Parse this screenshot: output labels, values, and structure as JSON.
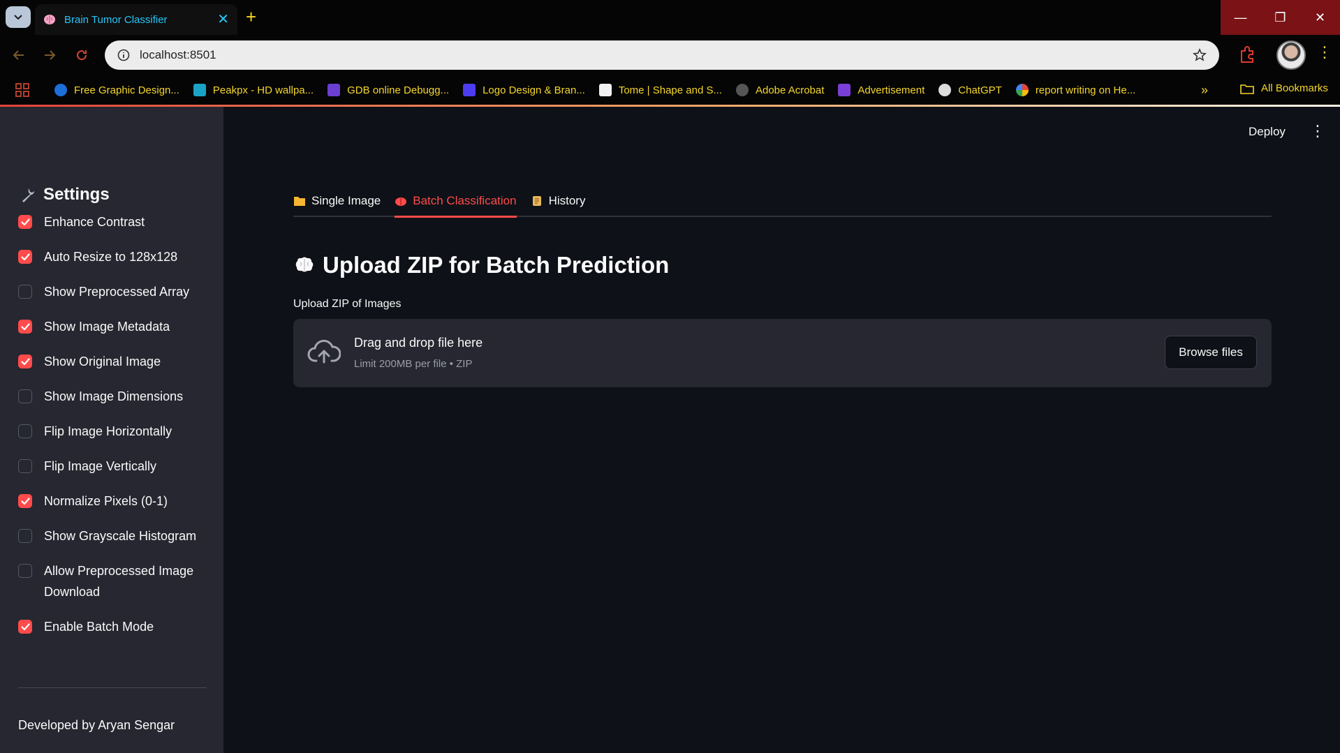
{
  "browser": {
    "tab_title": "Brain Tumor Classifier",
    "url": "localhost:8501",
    "bookmarks": [
      "Free Graphic Design...",
      "Peakpx - HD wallpa...",
      "GDB online Debugg...",
      "Logo Design & Bran...",
      "Tome | Shape and S...",
      "Adobe Acrobat",
      "Advertisement",
      "ChatGPT",
      "report writing on He..."
    ],
    "all_bookmarks": "All Bookmarks",
    "colors": {
      "bookmark_text": "#f4d62c",
      "tab_text": "#26c6f9",
      "window_controls": "#7a1216"
    }
  },
  "sidebar": {
    "heading": "Settings",
    "heading_icon": "wrench-icon",
    "options": [
      {
        "label": "Enhance Contrast",
        "checked": true
      },
      {
        "label": "Auto Resize to 128x128",
        "checked": true
      },
      {
        "label": "Show Preprocessed Array",
        "checked": false
      },
      {
        "label": "Show Image Metadata",
        "checked": true
      },
      {
        "label": "Show Original Image",
        "checked": true
      },
      {
        "label": "Show Image Dimensions",
        "checked": false
      },
      {
        "label": "Flip Image Horizontally",
        "checked": false
      },
      {
        "label": "Flip Image Vertically",
        "checked": false
      },
      {
        "label": "Normalize Pixels (0-1)",
        "checked": true
      },
      {
        "label": "Show Grayscale Histogram",
        "checked": false
      },
      {
        "label": "Allow Preprocessed Image Download",
        "checked": false
      },
      {
        "label": "Enable Batch Mode",
        "checked": true
      }
    ],
    "footer": "Developed by Aryan Sengar"
  },
  "header": {
    "deploy_label": "Deploy"
  },
  "tabs": [
    {
      "label": "Single Image",
      "icon": "folder-icon",
      "active": false
    },
    {
      "label": "Batch Classification",
      "icon": "brain-icon",
      "active": true
    },
    {
      "label": "History",
      "icon": "scroll-icon",
      "active": false
    }
  ],
  "main": {
    "title": "Upload ZIP for Batch Prediction",
    "upload_label": "Upload ZIP of Images",
    "dropzone_title": "Drag and drop file here",
    "dropzone_limit": "Limit 200MB per file • ZIP",
    "browse_label": "Browse files"
  },
  "colors": {
    "accent": "#ff4b4b",
    "sidebar_bg": "#262730",
    "main_bg": "#0e1117"
  }
}
